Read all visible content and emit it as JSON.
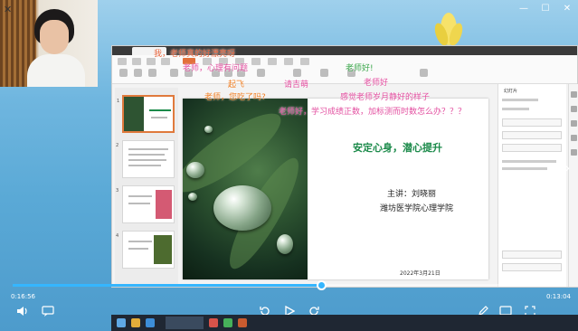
{
  "window": {
    "minimize_icon": "minimize-icon",
    "maximize_icon": "maximize-icon",
    "close_icon": "close-icon"
  },
  "slide": {
    "title": "安定心身，潜心提升",
    "speaker": "主讲：刘晓丽",
    "org": "潍坊医学院心理学院",
    "date": "2022年3月21日",
    "title_color": "#1b8a4a"
  },
  "danmaku": [
    "我，老师真的好漂亮呀",
    "老师，心理有问题",
    "起飞",
    "老师，您吃了吗?",
    "请吉萌",
    "感觉老师岁月静好的样子",
    "老师好，学习成绩正数，加标测而时数怎么办？？？",
    "老师好!",
    "老师好"
  ],
  "player": {
    "current_time": "0:16:56",
    "total_time": "0:13:04",
    "progress_fraction": 0.56,
    "accent": "#35b6ff",
    "volume_icon": "volume-icon",
    "danmaku_icon": "danmaku-icon",
    "rewind_icon": "rewind-icon",
    "play_icon": "play-icon",
    "forward_icon": "forward-icon",
    "edit_icon": "edit-icon",
    "screen_icon": "screen-icon",
    "fullscreen_icon": "fullscreen-icon"
  },
  "app": {
    "panel_title": "幻灯片",
    "accent": "#e07a3c"
  }
}
